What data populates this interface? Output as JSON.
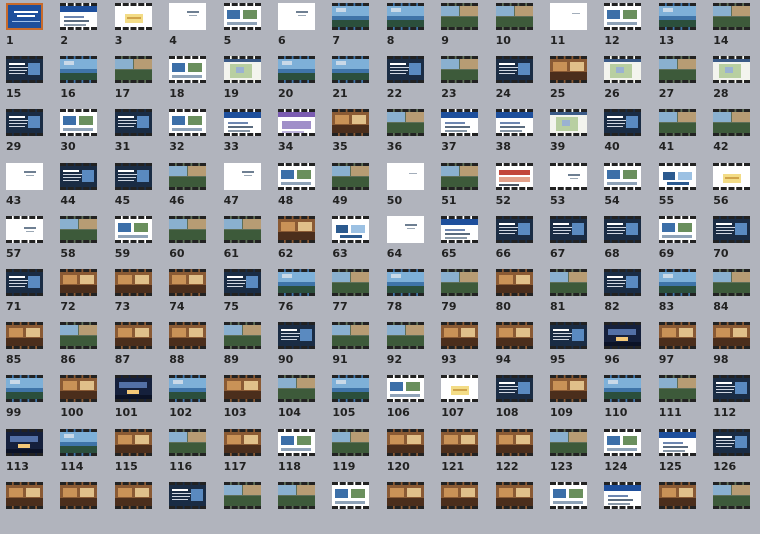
{
  "app": {
    "view": "slide-sorter"
  },
  "colors": {
    "background": "#b1b4bd",
    "selection": "#c86a2a",
    "slide_accent": "#1e4f9c",
    "slide_dark": "#1a2c44"
  },
  "selected_slide": 1,
  "slides": [
    {
      "label": "1",
      "style": "blue-title",
      "selected": true
    },
    {
      "label": "2",
      "style": "white-blue-bar"
    },
    {
      "label": "3",
      "style": "white-yellow"
    },
    {
      "label": "4",
      "style": "white-text"
    },
    {
      "label": "5",
      "style": "white-photos"
    },
    {
      "label": "6",
      "style": "white-text"
    },
    {
      "label": "7",
      "style": "photo-blue"
    },
    {
      "label": "8",
      "style": "photo-blue"
    },
    {
      "label": "9",
      "style": "photo-mix"
    },
    {
      "label": "10",
      "style": "photo-mix"
    },
    {
      "label": "11",
      "style": "white-blank"
    },
    {
      "label": "12",
      "style": "white-photos"
    },
    {
      "label": "13",
      "style": "photo-blue"
    },
    {
      "label": "14",
      "style": "photo-mix"
    },
    {
      "label": "15",
      "style": "dark-text"
    },
    {
      "label": "16",
      "style": "photo-blue"
    },
    {
      "label": "17",
      "style": "photo-mix"
    },
    {
      "label": "18",
      "style": "white-photos"
    },
    {
      "label": "19",
      "style": "white-map"
    },
    {
      "label": "20",
      "style": "photo-blue"
    },
    {
      "label": "21",
      "style": "photo-blue"
    },
    {
      "label": "22",
      "style": "dark-text"
    },
    {
      "label": "23",
      "style": "photo-mix"
    },
    {
      "label": "24",
      "style": "dark-text"
    },
    {
      "label": "25",
      "style": "photo-warm"
    },
    {
      "label": "26",
      "style": "white-map"
    },
    {
      "label": "27",
      "style": "photo-mix"
    },
    {
      "label": "28",
      "style": "white-map"
    },
    {
      "label": "29",
      "style": "dark-text"
    },
    {
      "label": "30",
      "style": "white-photos"
    },
    {
      "label": "31",
      "style": "dark-text"
    },
    {
      "label": "32",
      "style": "white-photos"
    },
    {
      "label": "33",
      "style": "white-blue-bar"
    },
    {
      "label": "34",
      "style": "white-purple"
    },
    {
      "label": "35",
      "style": "photo-warm"
    },
    {
      "label": "36",
      "style": "photo-mix"
    },
    {
      "label": "37",
      "style": "white-blue-bar"
    },
    {
      "label": "38",
      "style": "white-blue-bar"
    },
    {
      "label": "39",
      "style": "white-map"
    },
    {
      "label": "40",
      "style": "dark-text"
    },
    {
      "label": "41",
      "style": "photo-mix"
    },
    {
      "label": "42",
      "style": "photo-mix"
    },
    {
      "label": "43",
      "style": "white-text"
    },
    {
      "label": "44",
      "style": "dark-text"
    },
    {
      "label": "45",
      "style": "dark-text"
    },
    {
      "label": "46",
      "style": "photo-mix"
    },
    {
      "label": "47",
      "style": "white-text"
    },
    {
      "label": "48",
      "style": "white-photos"
    },
    {
      "label": "49",
      "style": "photo-mix"
    },
    {
      "label": "50",
      "style": "white-blank"
    },
    {
      "label": "51",
      "style": "photo-mix"
    },
    {
      "label": "52",
      "style": "white-red"
    },
    {
      "label": "53",
      "style": "white-text"
    },
    {
      "label": "54",
      "style": "white-photos"
    },
    {
      "label": "55",
      "style": "white-diagram"
    },
    {
      "label": "56",
      "style": "white-yellow"
    },
    {
      "label": "57",
      "style": "white-text"
    },
    {
      "label": "58",
      "style": "photo-mix"
    },
    {
      "label": "59",
      "style": "white-photos"
    },
    {
      "label": "60",
      "style": "photo-mix"
    },
    {
      "label": "61",
      "style": "photo-mix"
    },
    {
      "label": "62",
      "style": "photo-warm"
    },
    {
      "label": "63",
      "style": "white-diagram"
    },
    {
      "label": "64",
      "style": "white-text"
    },
    {
      "label": "65",
      "style": "white-blue-bar"
    },
    {
      "label": "66",
      "style": "dark-text"
    },
    {
      "label": "67",
      "style": "dark-text"
    },
    {
      "label": "68",
      "style": "dark-text"
    },
    {
      "label": "69",
      "style": "white-photos"
    },
    {
      "label": "70",
      "style": "dark-text"
    },
    {
      "label": "71",
      "style": "dark-text"
    },
    {
      "label": "72",
      "style": "photo-warm"
    },
    {
      "label": "73",
      "style": "photo-warm"
    },
    {
      "label": "74",
      "style": "photo-warm"
    },
    {
      "label": "75",
      "style": "dark-text"
    },
    {
      "label": "76",
      "style": "photo-blue"
    },
    {
      "label": "77",
      "style": "photo-mix"
    },
    {
      "label": "78",
      "style": "photo-blue"
    },
    {
      "label": "79",
      "style": "photo-mix"
    },
    {
      "label": "80",
      "style": "photo-warm"
    },
    {
      "label": "81",
      "style": "photo-mix"
    },
    {
      "label": "82",
      "style": "dark-text"
    },
    {
      "label": "83",
      "style": "photo-blue"
    },
    {
      "label": "84",
      "style": "photo-mix"
    },
    {
      "label": "85",
      "style": "photo-warm"
    },
    {
      "label": "86",
      "style": "photo-mix"
    },
    {
      "label": "87",
      "style": "photo-warm"
    },
    {
      "label": "88",
      "style": "photo-warm"
    },
    {
      "label": "89",
      "style": "photo-mix"
    },
    {
      "label": "90",
      "style": "dark-text"
    },
    {
      "label": "91",
      "style": "photo-mix"
    },
    {
      "label": "92",
      "style": "photo-mix"
    },
    {
      "label": "93",
      "style": "photo-warm"
    },
    {
      "label": "94",
      "style": "photo-warm"
    },
    {
      "label": "95",
      "style": "dark-text"
    },
    {
      "label": "96",
      "style": "photo-night"
    },
    {
      "label": "97",
      "style": "photo-warm"
    },
    {
      "label": "98",
      "style": "photo-warm"
    },
    {
      "label": "99",
      "style": "photo-blue"
    },
    {
      "label": "100",
      "style": "photo-warm"
    },
    {
      "label": "101",
      "style": "photo-night"
    },
    {
      "label": "102",
      "style": "photo-blue"
    },
    {
      "label": "103",
      "style": "photo-warm"
    },
    {
      "label": "104",
      "style": "photo-mix"
    },
    {
      "label": "105",
      "style": "photo-blue"
    },
    {
      "label": "106",
      "style": "white-photos"
    },
    {
      "label": "107",
      "style": "white-yellow"
    },
    {
      "label": "108",
      "style": "dark-text"
    },
    {
      "label": "109",
      "style": "photo-warm"
    },
    {
      "label": "110",
      "style": "photo-blue"
    },
    {
      "label": "111",
      "style": "photo-mix"
    },
    {
      "label": "112",
      "style": "dark-text"
    },
    {
      "label": "113",
      "style": "photo-night"
    },
    {
      "label": "114",
      "style": "photo-blue"
    },
    {
      "label": "115",
      "style": "photo-warm"
    },
    {
      "label": "116",
      "style": "photo-mix"
    },
    {
      "label": "117",
      "style": "photo-warm"
    },
    {
      "label": "118",
      "style": "white-photos"
    },
    {
      "label": "119",
      "style": "photo-mix"
    },
    {
      "label": "120",
      "style": "photo-warm"
    },
    {
      "label": "121",
      "style": "photo-warm"
    },
    {
      "label": "122",
      "style": "photo-warm"
    },
    {
      "label": "123",
      "style": "photo-mix"
    },
    {
      "label": "124",
      "style": "white-photos"
    },
    {
      "label": "125",
      "style": "white-blue-bar"
    },
    {
      "label": "126",
      "style": "dark-text"
    },
    {
      "label": "",
      "style": "photo-warm"
    },
    {
      "label": "",
      "style": "photo-warm"
    },
    {
      "label": "",
      "style": "photo-warm"
    },
    {
      "label": "",
      "style": "dark-text"
    },
    {
      "label": "",
      "style": "photo-mix"
    },
    {
      "label": "",
      "style": "photo-mix"
    },
    {
      "label": "",
      "style": "white-photos"
    },
    {
      "label": "",
      "style": "photo-warm"
    },
    {
      "label": "",
      "style": "photo-warm"
    },
    {
      "label": "",
      "style": "photo-warm"
    },
    {
      "label": "",
      "style": "white-photos"
    },
    {
      "label": "",
      "style": "white-blue-bar"
    },
    {
      "label": "",
      "style": "photo-warm"
    },
    {
      "label": "",
      "style": "photo-mix"
    }
  ]
}
